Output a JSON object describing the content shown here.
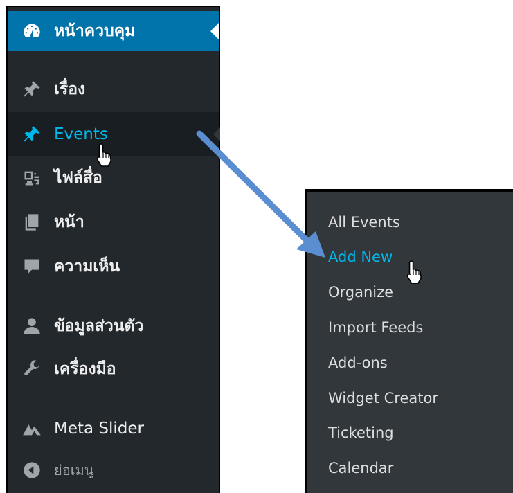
{
  "sidebar": {
    "items": [
      {
        "label": "หน้าควบคุม",
        "icon": "dashboard-gauge-icon",
        "state": "current"
      },
      {
        "label": "เรื่อง",
        "icon": "pushpin-icon"
      },
      {
        "label": "Events",
        "icon": "pushpin-icon",
        "state": "hover"
      },
      {
        "label": "ไฟล์สื่อ",
        "icon": "media-icon"
      },
      {
        "label": "หน้า",
        "icon": "pages-icon"
      },
      {
        "label": "ความเห็น",
        "icon": "comment-bubble-icon"
      },
      {
        "label": "ข้อมูลส่วนตัว",
        "icon": "user-icon"
      },
      {
        "label": "เครื่องมือ",
        "icon": "wrench-icon"
      },
      {
        "label": "Meta Slider",
        "icon": "mountain-icon"
      },
      {
        "label": "ย่อเมนู",
        "icon": "collapse-circle-left-icon"
      }
    ]
  },
  "submenu": {
    "items": [
      {
        "label": "All Events"
      },
      {
        "label": "Add New",
        "state": "active"
      },
      {
        "label": "Organize"
      },
      {
        "label": "Import Feeds"
      },
      {
        "label": "Add-ons"
      },
      {
        "label": "Widget Creator"
      },
      {
        "label": "Ticketing"
      },
      {
        "label": "Calendar"
      }
    ]
  },
  "colors": {
    "sidebar_bg": "#23282d",
    "current_bg": "#0073aa",
    "hover_bg": "#191e23",
    "submenu_bg": "#32373c",
    "accent": "#00b9eb",
    "icon_default": "#a0a5aa",
    "arrow": "#5b8ed0"
  }
}
